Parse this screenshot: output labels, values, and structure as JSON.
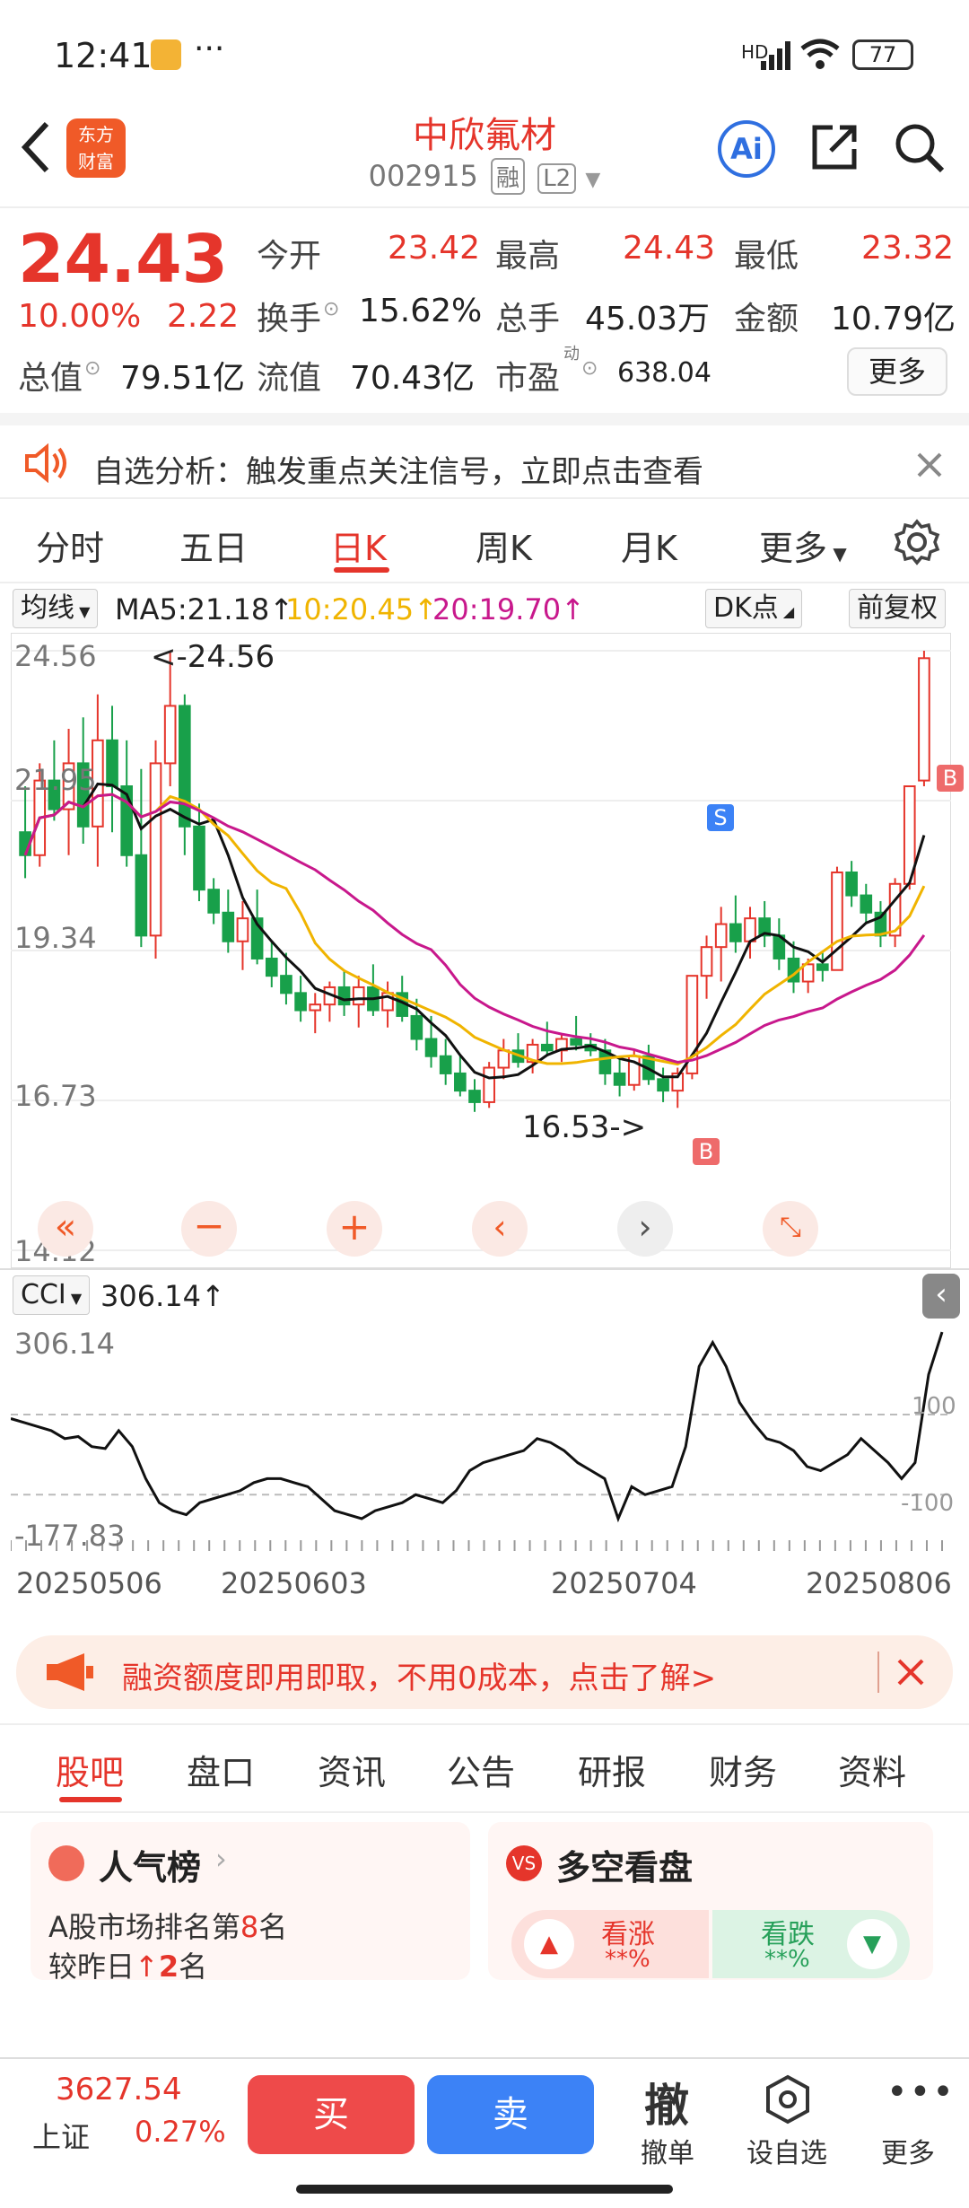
{
  "status_bar": {
    "time": "12:41",
    "dots": "···",
    "battery": "77",
    "net": "HD"
  },
  "header": {
    "title": "中欣氟材",
    "code": "002915",
    "tag_rong": "融",
    "tag_l2": "L2",
    "ai_label": "Ai",
    "logo_text_top": "东方",
    "logo_text_bottom": "财富"
  },
  "quote": {
    "price": "24.43",
    "change_pct": "10.00%",
    "change": "2.22",
    "open_label": "今开",
    "open": "23.42",
    "high_label": "最高",
    "high": "24.43",
    "low_label": "最低",
    "low": "23.32",
    "turnover_label": "换手",
    "turnover": "15.62%",
    "volume_label": "总手",
    "volume": "45.03万",
    "amount_label": "金额",
    "amount": "10.79亿",
    "mktcap_label": "总值",
    "mktcap": "79.51亿",
    "float_label": "流值",
    "float": "70.43亿",
    "pe_label": "市盈",
    "pe_sup": "动",
    "pe": "638.04",
    "more": "更多"
  },
  "notice": {
    "text": "自选分析：触发重点关注信号，立即点击查看"
  },
  "kline_tabs": [
    "分时",
    "五日",
    "日K",
    "周K",
    "月K",
    "更多"
  ],
  "ma_row": {
    "selector": "均线",
    "ma5": "MA5:21.18",
    "ma10": "10:20.45",
    "ma20": "20:19.70",
    "dk": "DK点",
    "fq": "前复权"
  },
  "chart_main": {
    "y_labels": [
      "24.56",
      "21.95",
      "19.34",
      "16.73",
      "14.12"
    ],
    "high_note": "<-24.56",
    "low_note": "16.53->",
    "s_marker": "S",
    "b_marker": "B"
  },
  "cci_row": {
    "selector": "CCI",
    "value": "306.14",
    "y_top": "306.14",
    "y_bottom": "-177.83",
    "ref_100": "100",
    "ref_m100": "-100"
  },
  "dates": [
    "20250506",
    "20250603",
    "20250704",
    "20250806"
  ],
  "banner": {
    "text": "融资额度即用即取，不用0成本，点击了解>"
  },
  "bottom_tabs": [
    "股吧",
    "盘口",
    "资讯",
    "公告",
    "研报",
    "财务",
    "资料"
  ],
  "card_popular": {
    "title": "人气榜",
    "line1_prefix": "A股市场排名第",
    "rank": "8",
    "line1_suffix": "名",
    "line2_prefix": "较昨日",
    "delta": "2",
    "line2_suffix": "名"
  },
  "card_duokong": {
    "title": "多空看盘",
    "up_label": "看涨",
    "up_pct": "**%",
    "down_label": "看跌",
    "down_pct": "**%"
  },
  "bottom_bar": {
    "index_value": "3627.54",
    "index_name": "上证",
    "index_pct": "0.27%",
    "buy": "买",
    "sell": "卖",
    "cancel_big": "撤",
    "cancel": "撤单",
    "watch": "设自选",
    "more": "更多"
  },
  "chart_data": {
    "type": "candlestick",
    "x_range": [
      "20250506",
      "20250806"
    ],
    "ylim": [
      14.12,
      24.56
    ],
    "y_ticks": [
      24.56,
      21.95,
      19.34,
      16.73,
      14.12
    ],
    "ma5_last": 21.18,
    "ma10_last": 20.45,
    "ma20_last": 19.7,
    "candles": [
      [
        21.4,
        22.2,
        20.6,
        21.0
      ],
      [
        21.0,
        22.6,
        20.8,
        22.3
      ],
      [
        22.3,
        23.0,
        21.6,
        21.8
      ],
      [
        21.8,
        23.2,
        21.0,
        22.6
      ],
      [
        22.6,
        23.4,
        21.2,
        21.5
      ],
      [
        21.5,
        23.8,
        20.8,
        23.0
      ],
      [
        23.0,
        23.6,
        21.4,
        22.2
      ],
      [
        22.2,
        23.0,
        20.8,
        21.0
      ],
      [
        21.0,
        22.5,
        19.4,
        19.6
      ],
      [
        19.6,
        23.0,
        19.2,
        22.6
      ],
      [
        22.6,
        24.56,
        22.2,
        23.6
      ],
      [
        23.6,
        23.8,
        21.0,
        21.5
      ],
      [
        21.5,
        21.9,
        20.2,
        20.4
      ],
      [
        20.4,
        20.6,
        19.8,
        20.0
      ],
      [
        20.0,
        20.4,
        19.3,
        19.5
      ],
      [
        19.5,
        20.2,
        19.0,
        19.9
      ],
      [
        19.9,
        20.4,
        19.1,
        19.2
      ],
      [
        19.2,
        19.5,
        18.7,
        18.9
      ],
      [
        18.9,
        19.3,
        18.4,
        18.6
      ],
      [
        18.6,
        18.9,
        18.1,
        18.3
      ],
      [
        18.3,
        18.6,
        17.9,
        18.4
      ],
      [
        18.4,
        18.8,
        18.1,
        18.7
      ],
      [
        18.7,
        19.0,
        18.2,
        18.4
      ],
      [
        18.4,
        18.9,
        18.0,
        18.7
      ],
      [
        18.7,
        19.1,
        18.2,
        18.3
      ],
      [
        18.3,
        18.8,
        18.0,
        18.6
      ],
      [
        18.6,
        18.9,
        18.1,
        18.2
      ],
      [
        18.2,
        18.5,
        17.6,
        17.8
      ],
      [
        17.8,
        18.2,
        17.3,
        17.5
      ],
      [
        17.5,
        17.8,
        17.0,
        17.2
      ],
      [
        17.2,
        17.5,
        16.8,
        16.9
      ],
      [
        16.9,
        17.1,
        16.53,
        16.7
      ],
      [
        16.7,
        17.4,
        16.6,
        17.3
      ],
      [
        17.3,
        17.8,
        17.1,
        17.6
      ],
      [
        17.6,
        17.9,
        17.3,
        17.4
      ],
      [
        17.4,
        17.8,
        17.2,
        17.7
      ],
      [
        17.7,
        18.1,
        17.5,
        17.6
      ],
      [
        17.6,
        17.9,
        17.4,
        17.8
      ],
      [
        17.8,
        18.2,
        17.6,
        17.7
      ],
      [
        17.7,
        17.9,
        17.5,
        17.6
      ],
      [
        17.6,
        17.8,
        17.0,
        17.2
      ],
      [
        17.2,
        17.5,
        16.8,
        17.0
      ],
      [
        17.0,
        17.6,
        16.9,
        17.5
      ],
      [
        17.5,
        17.7,
        17.0,
        17.1
      ],
      [
        17.1,
        17.3,
        16.7,
        16.9
      ],
      [
        16.9,
        17.3,
        16.6,
        17.2
      ],
      [
        17.2,
        18.9,
        17.1,
        18.9
      ],
      [
        18.9,
        19.6,
        18.5,
        19.4
      ],
      [
        19.4,
        20.1,
        18.8,
        19.8
      ],
      [
        19.8,
        20.3,
        19.3,
        19.5
      ],
      [
        19.5,
        20.1,
        19.2,
        19.9
      ],
      [
        19.9,
        20.2,
        19.4,
        19.6
      ],
      [
        19.6,
        19.9,
        19.0,
        19.2
      ],
      [
        19.2,
        19.5,
        18.6,
        18.8
      ],
      [
        18.8,
        19.2,
        18.6,
        19.1
      ],
      [
        19.1,
        19.3,
        18.8,
        19.0
      ],
      [
        19.0,
        20.8,
        19.0,
        20.7
      ],
      [
        20.7,
        20.9,
        20.1,
        20.3
      ],
      [
        20.3,
        20.5,
        19.8,
        20.0
      ],
      [
        20.0,
        20.2,
        19.4,
        19.6
      ],
      [
        19.6,
        20.6,
        19.4,
        20.5
      ],
      [
        20.5,
        22.2,
        20.4,
        22.2
      ],
      [
        22.3,
        24.56,
        22.2,
        24.43
      ]
    ],
    "cci": [
      90,
      80,
      70,
      60,
      40,
      45,
      20,
      15,
      60,
      20,
      -60,
      -120,
      -140,
      -150,
      -120,
      -110,
      -100,
      -90,
      -70,
      -60,
      -60,
      -70,
      -80,
      -110,
      -140,
      -150,
      -160,
      -140,
      -130,
      -120,
      -100,
      -110,
      -120,
      -90,
      -40,
      -20,
      -10,
      0,
      10,
      40,
      30,
      10,
      -20,
      -40,
      -60,
      -160,
      -80,
      -100,
      -90,
      -80,
      20,
      220,
      280,
      220,
      130,
      80,
      40,
      30,
      10,
      -30,
      -40,
      -20,
      0,
      40,
      10,
      -20,
      -60,
      -20,
      200,
      306
    ]
  }
}
